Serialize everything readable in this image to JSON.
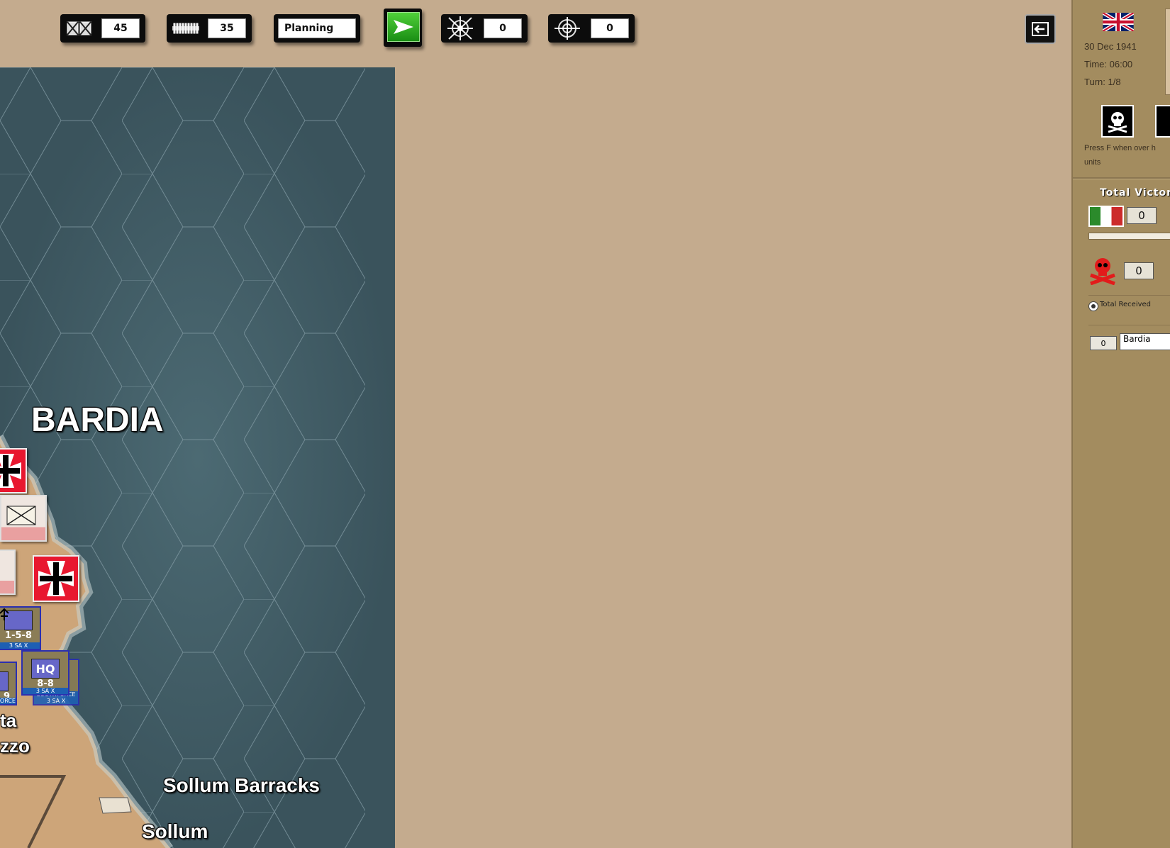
{
  "toolbar": {
    "supply_value": "45",
    "ammo_value": "35",
    "phase": "Planning",
    "target_a_value": "0",
    "target_b_value": "0"
  },
  "map": {
    "labels": {
      "bardia": "BARDIA",
      "sollum_barracks": "Sollum Barracks",
      "sollum": "Sollum",
      "ta": "ta",
      "zzo": "zzo"
    },
    "units": {
      "infantry": {
        "strength": "1-5-8",
        "formation": "3 SA X",
        "number": "3",
        "size": "1",
        "corner": "8"
      },
      "hq": {
        "symbol": "HQ",
        "strength": "8-8",
        "formation": "3 SA X",
        "size": "X",
        "corner": "1"
      },
      "hq_stack": {
        "formation": "SOUTHFORCE",
        "sub": "3 SA X"
      },
      "partial": {
        "strength": "9",
        "formation": "ORCE"
      }
    }
  },
  "side": {
    "date": "30 Dec 1941",
    "time": "Time: 06:00",
    "turn": "Turn: 1/8",
    "hint_line1": "Press F when over h",
    "hint_line2": "units",
    "victory_title": "Total Victory",
    "axis_vp": "0",
    "casualties_vp": "0",
    "radio_label": "Total Received",
    "location_value": "0",
    "location_name": "Bardia"
  },
  "colors": {
    "background": "#c4ab8e",
    "sea": "#3e5a64",
    "panel": "#a38c5f",
    "german_counter": "#e8172f",
    "allied_counter": "#8b7d56",
    "next_button": "#2fae22"
  }
}
